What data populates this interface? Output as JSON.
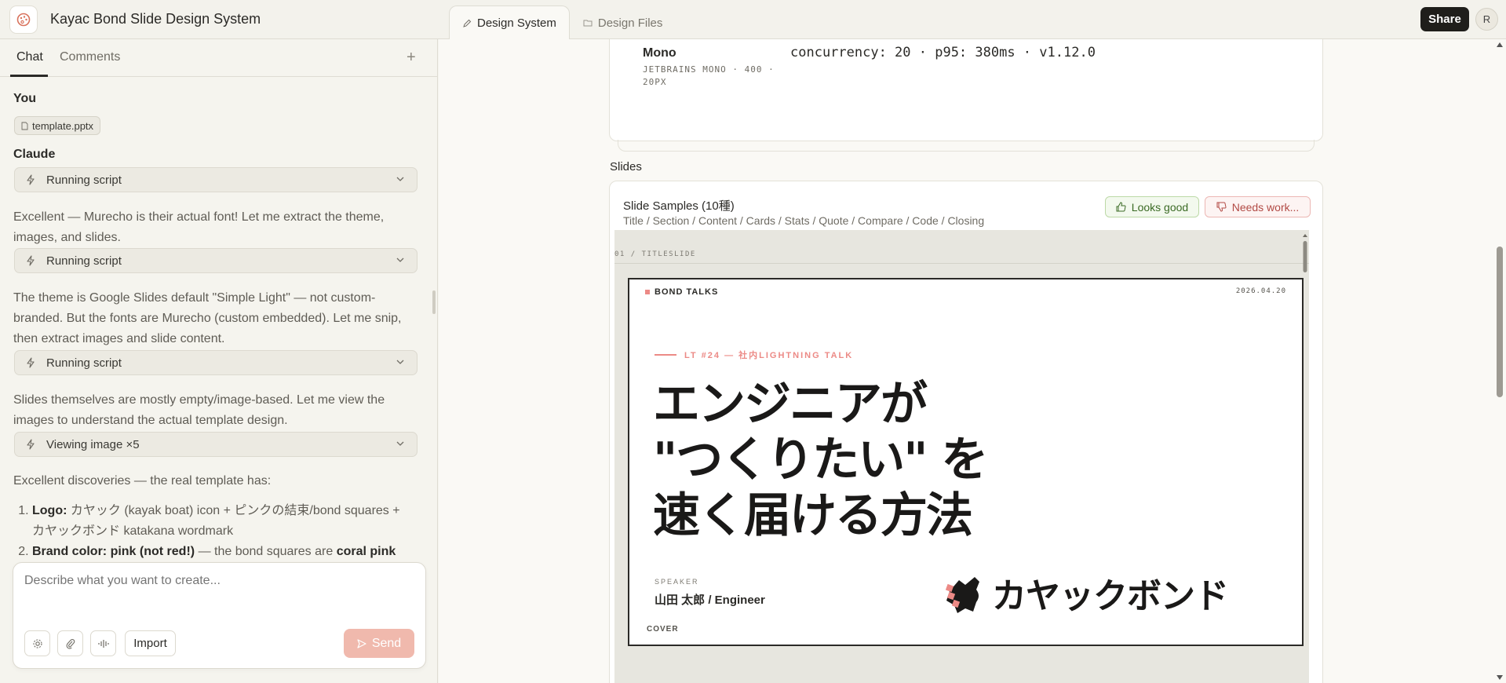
{
  "app": {
    "title": "Kayac Bond Slide Design System"
  },
  "tabs": [
    {
      "label": "Design System",
      "active": true
    },
    {
      "label": "Design Files",
      "active": false
    }
  ],
  "header": {
    "share_label": "Share",
    "avatar_initial": "R"
  },
  "panel": {
    "tabs": [
      {
        "label": "Chat",
        "active": true
      },
      {
        "label": "Comments",
        "active": false
      }
    ],
    "add_label": "+"
  },
  "chat": {
    "user_author": "You",
    "attachment": "template.pptx",
    "assistant_author": "Claude",
    "tool1": "Running script",
    "msg1": "Excellent — Murecho is their actual font! Let me extract the theme, images, and slides.",
    "tool2": "Running script",
    "msg2": "The theme is Google Slides default \"Simple Light\" — not custom-branded. But the fonts are Murecho (custom embedded). Let me snip, then extract images and slide content.",
    "tool3": "Running script",
    "msg3": "Slides themselves are mostly empty/image-based. Let me view the images to understand the actual template design.",
    "tool4": "Viewing image ×5",
    "msg4": "Excellent discoveries — the real template has:",
    "list": [
      {
        "label": "Logo:",
        "text": "カヤック (kayak boat) icon + ピンクの結束/bond squares + カヤックボンド katakana wordmark"
      },
      {
        "label": "Brand color: pink (not red!)",
        "text": "— the bond squares are",
        "strong": "coral pink"
      }
    ]
  },
  "composer": {
    "placeholder": "Describe what you want to create...",
    "import_label": "Import",
    "send_label": "Send"
  },
  "typography": {
    "name": "Mono",
    "meta": "JETBRAINS MONO · 400 · 20PX",
    "sample": "concurrency: 20 · p95: 380ms · v1.12.0"
  },
  "slides_section": {
    "label": "Slides",
    "card_title": "Slide Samples (10種)",
    "card_subtitle": "Title / Section / Content / Cards / Stats / Quote / Compare / Code / Closing",
    "looks_good": "Looks good",
    "needs_work": "Needs work..."
  },
  "slide": {
    "tag": "01 / TITLESLIDE",
    "brand": "BOND TALKS",
    "date": "2026.04.20",
    "eyebrow": "LT #24 — 社内LIGHTNING TALK",
    "title_lines": [
      "エンジニアが",
      "\"つくりたい\" を",
      "速く届ける方法"
    ],
    "speaker_label": "SPEAKER",
    "speaker": "山田 太郎 / Engineer",
    "cover": "COVER",
    "logo_wordmark": "カヤックボンド"
  },
  "colors": {
    "accent_pink": "#ec8a86",
    "send_disabled": "#f0b9ad",
    "ink": "#1a1918"
  },
  "icons": [
    "palette-icon",
    "pen-icon",
    "folder-icon",
    "lightning-icon",
    "chevron-down-icon",
    "file-icon",
    "settings-icon",
    "paperclip-icon",
    "audio-icon",
    "send-icon",
    "thumbs-up-icon",
    "thumbs-down-icon"
  ]
}
